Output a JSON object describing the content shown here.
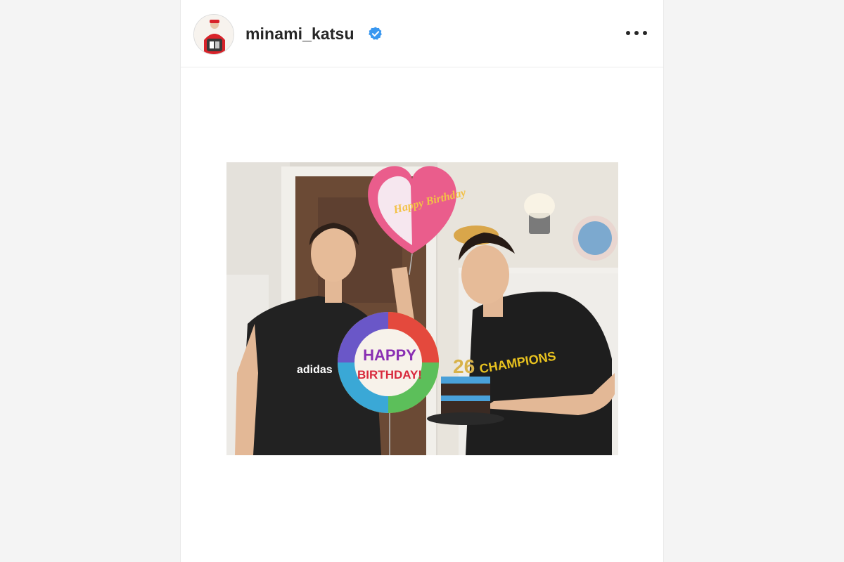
{
  "post": {
    "username": "minami_katsu",
    "verified": true,
    "more_icon": "more-horizontal-icon",
    "verified_icon": "verified-badge-icon"
  },
  "photo": {
    "balloon_heart_text": "Happy Birthday",
    "balloon_round_text_1": "HAPPY",
    "balloon_round_text_2": "BIRTHDAY!",
    "shirt_left_text": "adidas",
    "shirt_right_text": "CHAMPIONS",
    "cake_topper": "26"
  },
  "colors": {
    "verified_blue": "#3897f0",
    "text": "#262626",
    "divider": "#ececec"
  }
}
